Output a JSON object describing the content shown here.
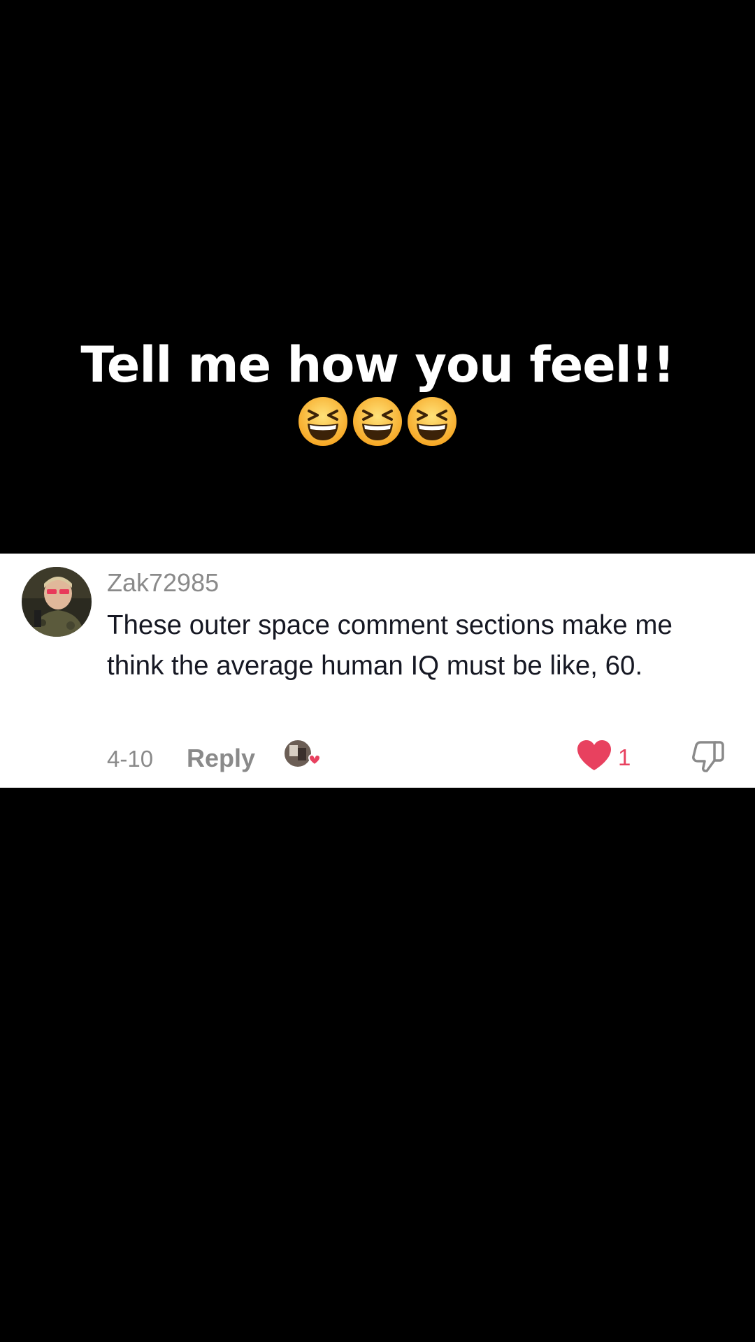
{
  "caption": {
    "line1": "Tell me how you feel!!",
    "emojis": [
      "laughing-face-emoji",
      "laughing-face-emoji",
      "laughing-face-emoji"
    ]
  },
  "comment": {
    "username": "Zak72985",
    "text": "These outer space comment sections make me think the average human IQ must be like, 60.",
    "date": "4-10",
    "reply_label": "Reply",
    "like_count": "1",
    "liked": true
  },
  "colors": {
    "background": "#000000",
    "card": "#ffffff",
    "like_red": "#e8415f",
    "meta_gray": "#8a8a8a",
    "text_dark": "#161823"
  },
  "icons": {
    "like": "heart-icon",
    "dislike": "thumbs-down-icon",
    "creator_liked": "creator-liked-badge-icon"
  }
}
